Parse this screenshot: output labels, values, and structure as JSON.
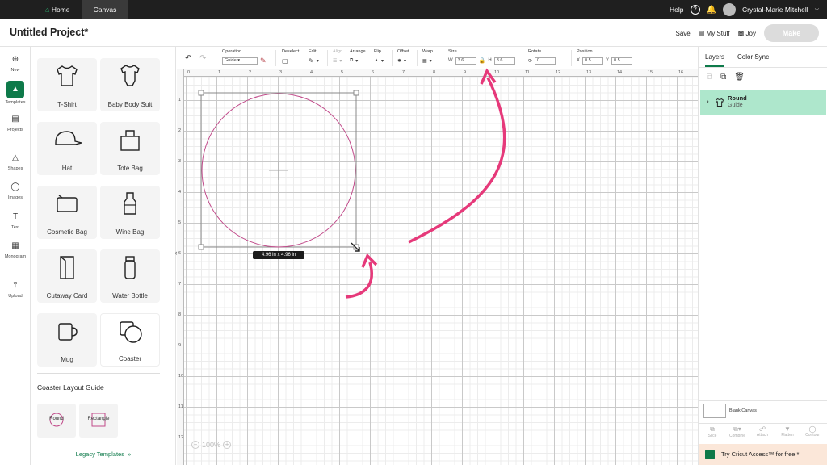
{
  "topbar": {
    "home_label": "Home",
    "canvas_tab": "Canvas",
    "help_label": "Help",
    "help_icon": "?",
    "user_name": "Crystal-Marie Mitchell"
  },
  "header": {
    "project_title": "Untitled Project*",
    "save_label": "Save",
    "mystuff_label": "My Stuff",
    "joy_label": "Joy",
    "make_label": "Make"
  },
  "rail": {
    "items": [
      {
        "label": "New",
        "icon": "plus-circle-icon"
      },
      {
        "label": "Templates",
        "icon": "shirt-icon"
      },
      {
        "label": "Projects",
        "icon": "projects-icon"
      },
      {
        "label": "Shapes",
        "icon": "shapes-icon"
      },
      {
        "label": "Images",
        "icon": "lightbulb-icon"
      },
      {
        "label": "Text",
        "icon": "text-icon"
      },
      {
        "label": "Monogram",
        "icon": "monogram-icon"
      },
      {
        "label": "Upload",
        "icon": "upload-icon"
      }
    ]
  },
  "templates": {
    "items": [
      "T-Shirt",
      "Baby Body Suit",
      "Hat",
      "Tote Bag",
      "Cosmetic Bag",
      "Wine Bag",
      "Cutaway Card",
      "Water Bottle",
      "Mug",
      "Coaster"
    ],
    "layout_guide_title": "Coaster Layout Guide",
    "guides": [
      "Round",
      "Rectangle"
    ],
    "legacy_label": "Legacy Templates"
  },
  "toolbar": {
    "operation_label": "Operation",
    "operation_value": "Guide",
    "deselect_label": "Deselect",
    "edit_label": "Edit",
    "align_label": "Align",
    "arrange_label": "Arrange",
    "flip_label": "Flip",
    "offset_label": "Offset",
    "warp_label": "Warp",
    "size_label": "Size",
    "w_label": "W",
    "w_value": "3.6",
    "h_label": "H",
    "h_value": "3.6",
    "rotate_label": "Rotate",
    "rotate_value": "0",
    "position_label": "Position",
    "x_label": "X",
    "x_value": "0.5",
    "y_label": "Y",
    "y_value": "0.5"
  },
  "canvas": {
    "ruler_numbers": [
      "0",
      "1",
      "2",
      "3",
      "4",
      "5",
      "6",
      "7",
      "8",
      "9",
      "10",
      "11",
      "12",
      "13",
      "14",
      "15",
      "16"
    ],
    "dimension_label": "4.96  in x 4.96  in",
    "zoom_label": "100%",
    "accent_pink": "#e6397a"
  },
  "right_panel": {
    "tab_layers": "Layers",
    "tab_color_sync": "Color Sync",
    "layer_name": "Round",
    "layer_sub": "Guide",
    "blank_canvas_label": "Blank Canvas",
    "actions": [
      "Slice",
      "Combine",
      "Attach",
      "Flatten",
      "Contour"
    ],
    "access_label": "Try Cricut Access™ for free.*"
  },
  "colors": {
    "brand_green": "#0e7a4a",
    "layer_highlight": "#aee7cc",
    "topbar_bg": "#1f1f1f"
  }
}
